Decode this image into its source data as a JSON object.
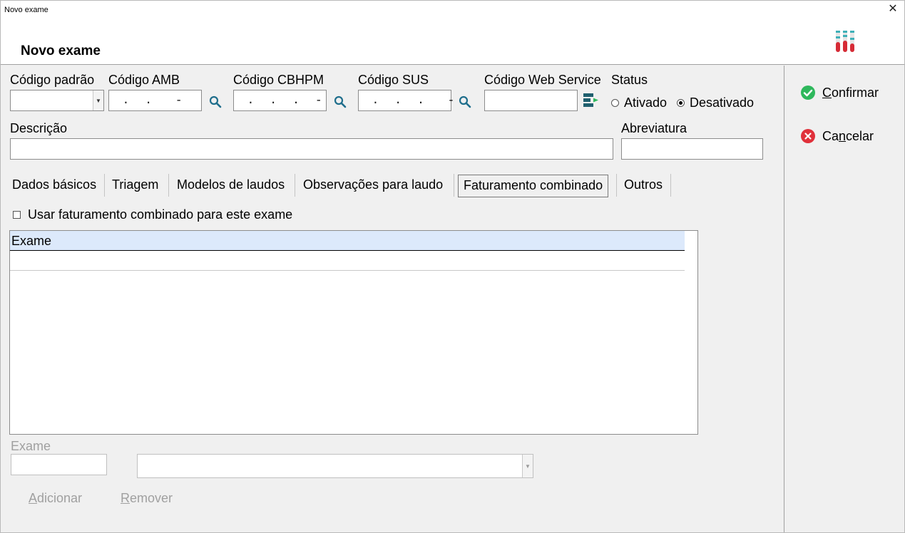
{
  "window": {
    "title": "Novo exame",
    "close_glyph": "✕"
  },
  "header": {
    "page_title": "Novo exame",
    "logo_icon": "test-tubes-icon"
  },
  "codes": {
    "padrao": {
      "label": "Código padrão",
      "value": ""
    },
    "amb": {
      "label": "Código AMB",
      "value": " .  .   -"
    },
    "cbhpm": {
      "label": "Código CBHPM",
      "value": " .  .  .  -"
    },
    "sus": {
      "label": "Código SUS",
      "value": " .  .  .   -"
    },
    "web_service": {
      "label": "Código Web Service",
      "value": ""
    }
  },
  "status": {
    "label": "Status",
    "options": [
      {
        "label": "Ativado",
        "selected": false
      },
      {
        "label": "Desativado",
        "selected": true
      }
    ]
  },
  "descricao": {
    "label": "Descrição",
    "value": ""
  },
  "abreviatura": {
    "label": "Abreviatura",
    "value": ""
  },
  "tabs": [
    {
      "label": "Dados básicos",
      "active": false
    },
    {
      "label": "Triagem",
      "active": false
    },
    {
      "label": "Modelos de laudos",
      "active": false
    },
    {
      "label": "Observações para laudo",
      "active": false
    },
    {
      "label": "Faturamento combinado",
      "active": true
    },
    {
      "label": "Outros",
      "active": false
    }
  ],
  "faturamento": {
    "checkbox_label": "Usar faturamento combinado para este exame",
    "checked": false,
    "grid": {
      "columns": [
        "Exame"
      ],
      "rows": []
    },
    "exame_label": "Exame",
    "exame_code_value": "",
    "exame_select_value": "",
    "add_button": {
      "hotkey": "A",
      "rest": "dicionar"
    },
    "remove_button": {
      "hotkey": "R",
      "rest": "emover"
    }
  },
  "actions": {
    "confirm": {
      "hotkey": "C",
      "rest": "onfirmar",
      "color": "#2eb85c"
    },
    "cancel": {
      "pre": "Ca",
      "hotkey": "n",
      "rest": "celar",
      "color": "#e0303a"
    }
  }
}
